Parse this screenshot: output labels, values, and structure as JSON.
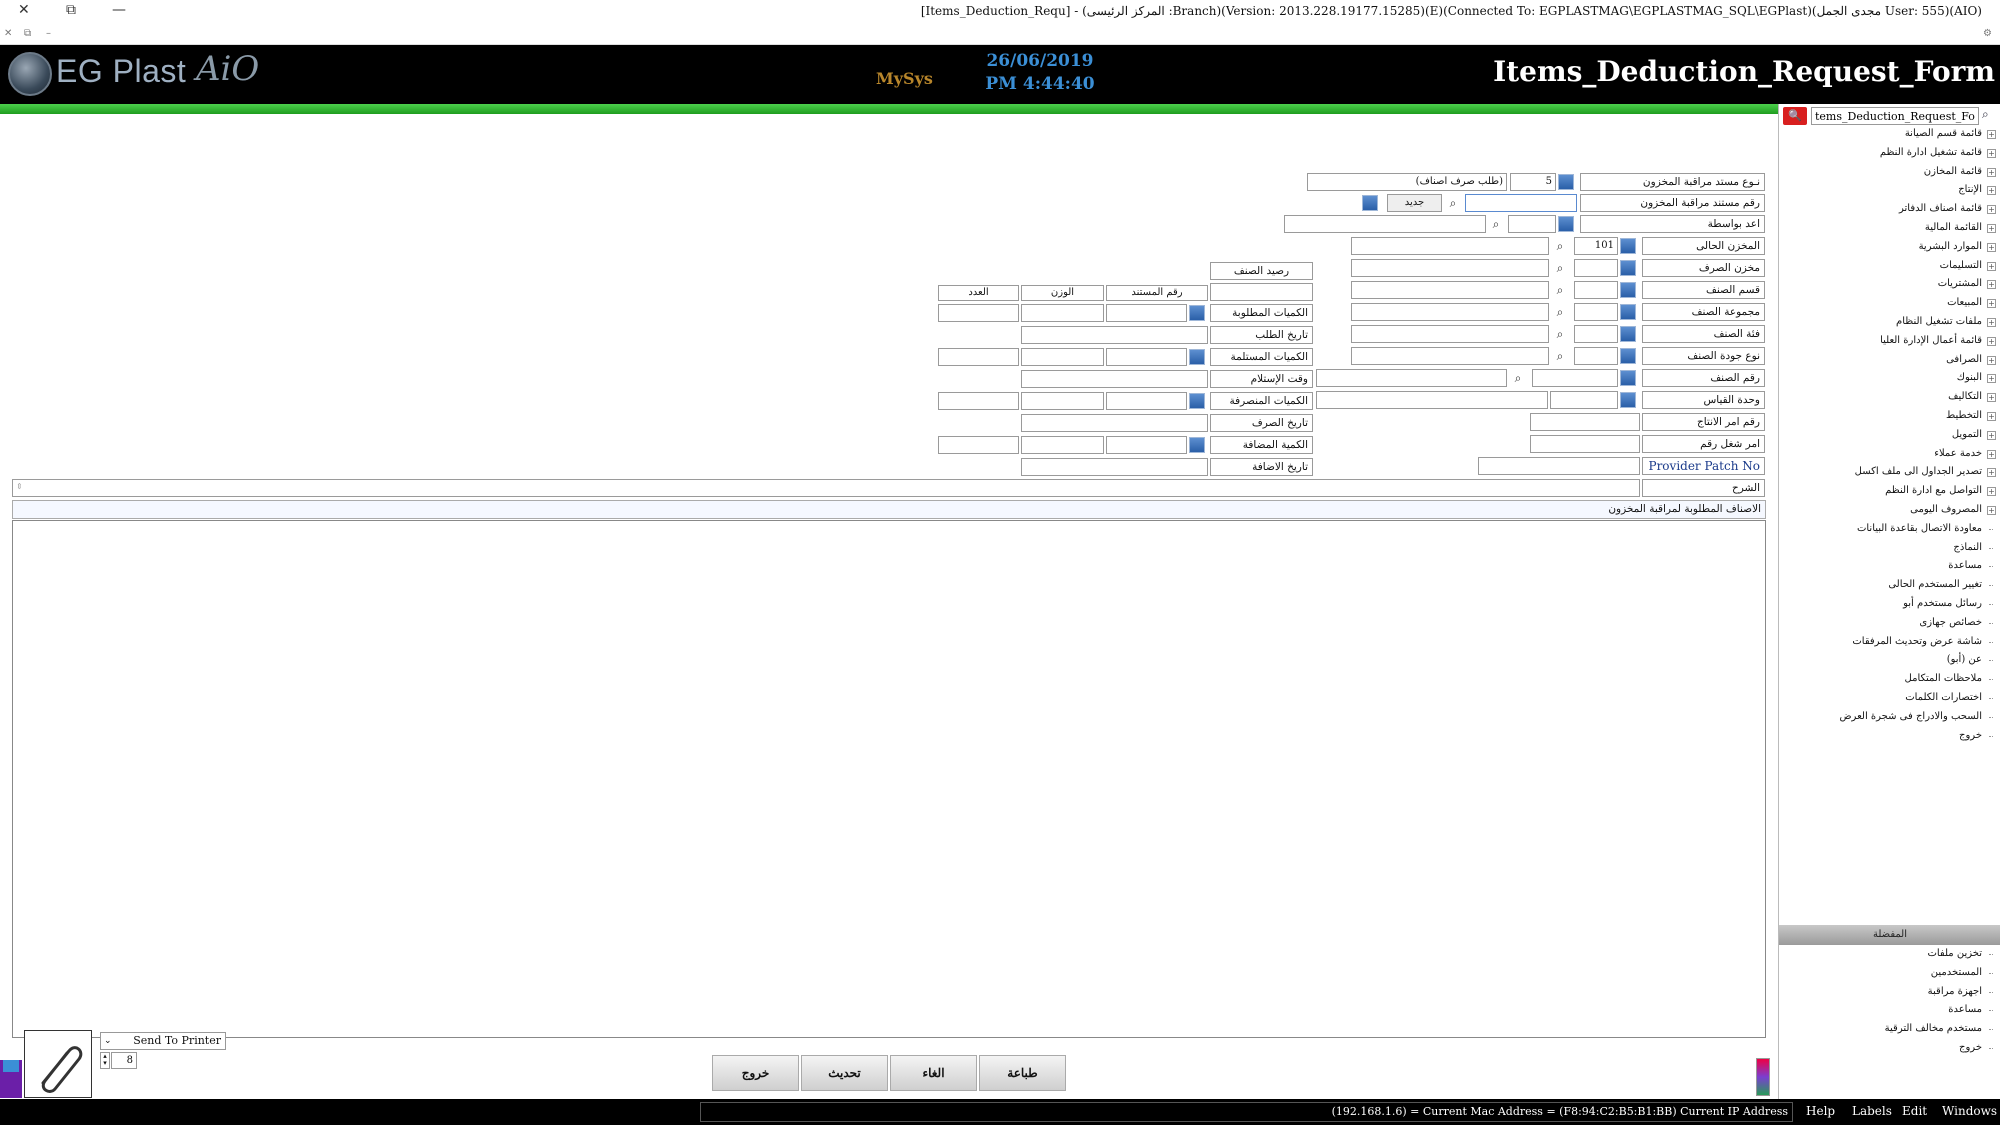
{
  "window": {
    "title": "[Items_Deduction_Requ] - (المركز الرئيسى :Branch)(Version: 2013.228.19177.15285)(E)(Connected To: EGPLASTMAG\\EGPLASTMAG_SQL\\EGPlast)(مجدى الجمل User: 555)(AIO)",
    "close": "✕",
    "restore": "⧉",
    "minimize": "—"
  },
  "header": {
    "logo_text": "EG Plast",
    "logo_suffix": "AiO",
    "mysys": "MySys",
    "date": "26/06/2019",
    "time": "PM 4:44:40",
    "form_title": "Items_Deduction_Request_Form"
  },
  "sidebar": {
    "search_value": "tems_Deduction_Request_Form",
    "tree": [
      {
        "label": "قائمة قسم الصيانة",
        "expand": true
      },
      {
        "label": "قائمة تشغيل ادارة النظم",
        "expand": true
      },
      {
        "label": "قائمة المخازن",
        "expand": true
      },
      {
        "label": "الإنتاج",
        "expand": true
      },
      {
        "label": "قائمة اصناف الدفاتر",
        "expand": true
      },
      {
        "label": "القائمة المالية",
        "expand": true
      },
      {
        "label": "الموارد البشرية",
        "expand": true
      },
      {
        "label": "التسليمات",
        "expand": true
      },
      {
        "label": "المشتريات",
        "expand": true
      },
      {
        "label": "المبيعات",
        "expand": true
      },
      {
        "label": "ملفات تشغيل النظام",
        "expand": true
      },
      {
        "label": "قائمة أعمال الإدارة العليا",
        "expand": true
      },
      {
        "label": "الصرافى",
        "expand": true
      },
      {
        "label": "البنوك",
        "expand": true
      },
      {
        "label": "التكاليف",
        "expand": true
      },
      {
        "label": "التخطيط",
        "expand": true
      },
      {
        "label": "التمويل",
        "expand": true
      },
      {
        "label": "خدمة عملاء",
        "expand": true
      },
      {
        "label": "تصدير الجداول الى ملف اكسل",
        "expand": true
      },
      {
        "label": "التواصل مع ادارة النظم",
        "expand": true
      },
      {
        "label": "المصروف اليومى",
        "expand": true
      },
      {
        "label": "معاودة الاتصال بقاعدة البيانات",
        "expand": false
      },
      {
        "label": "النماذج",
        "expand": false
      },
      {
        "label": "مساعدة",
        "expand": false
      },
      {
        "label": "تغيير المستخدم الحالى",
        "expand": false
      },
      {
        "label": "رسائل مستخدم أبو",
        "expand": false
      },
      {
        "label": "خصائص جهازى",
        "expand": false
      },
      {
        "label": "شاشة عرض وتحديث المرفقات",
        "expand": false
      },
      {
        "label": "عن (أبو)",
        "expand": false
      },
      {
        "label": "ملاحظات المتكامل",
        "expand": false
      },
      {
        "label": "اختصارات الكلمات",
        "expand": false
      },
      {
        "label": "السحب والادراج فى شجرة العرض",
        "expand": false
      },
      {
        "label": "خروج",
        "expand": false
      }
    ],
    "favorites_title": "المفضلة",
    "favorites": [
      {
        "label": "تخزين ملفات"
      },
      {
        "label": "المستخدمين"
      },
      {
        "label": "اجهزة مراقبة"
      },
      {
        "label": "مساعدة"
      },
      {
        "label": "مستخدم مخالف الترقية"
      },
      {
        "label": "خروج"
      }
    ]
  },
  "form": {
    "doc_type_label": "نـوع مستد مراقبة المخزون",
    "doc_type_code": "5",
    "doc_type_name": "(طلب صرف اصناف)",
    "doc_no_label": "رقم مستند مراقبة المخزون",
    "doc_no_value": "",
    "new_button": "جديد",
    "prepared_by_label": "اعد بواسطة",
    "current_store_label": "المخزن الحالى",
    "current_store_code": "101",
    "issue_store_label": "مخزن الصرف",
    "item_section_label": "قسم الصنف",
    "item_group_label": "مجموعة الصنف",
    "item_category_label": "فئة الصنف",
    "item_quality_label": "نوع جودة الصنف",
    "item_no_label": "رقم الصنف",
    "unit_label": "وحدة القياس",
    "prod_order_label": "رقم امر الانتاج",
    "work_order_label": "امر شغل رقم",
    "provider_patch_label": "Provider Patch No",
    "notes_label": "الشرح",
    "item_balance_label": "رصيد الصنف",
    "col_doc_no": "رقم المستند",
    "col_weight": "الوزن",
    "col_count": "العدد",
    "req_qty_label": "الكميات المطلوبة",
    "req_date_label": "تاريخ الطلب",
    "recv_qty_label": "الكميات المستلمة",
    "recv_time_label": "وقت الإستلام",
    "issued_qty_label": "الكميات المنصرفة",
    "issue_date_label": "تاريخ الصرف",
    "added_qty_label": "الكمية المضافة",
    "add_date_label": "تاريخ الاضافة",
    "grid_title": "الاصناف المطلوبة لمراقبة المخزون"
  },
  "bottom": {
    "send_to_printer": "Send To Printer",
    "copies": "8",
    "print_button": "طباعة",
    "cancel_button": "الغاء",
    "update_button": "تحديث",
    "exit_button": "خروج"
  },
  "statusbar": {
    "ip_text": "(192.168.1.6) = Current Mac Address = (F8:94:C2:B5:B1:BB) Current IP Address",
    "menu": [
      "Help",
      "Labels",
      "Edit",
      "Windows"
    ]
  },
  "colors": {
    "accent_green": "#1f9d1f",
    "header_bg": "#000000",
    "date_blue": "#3b8fd6",
    "search_red": "#d81f1f"
  }
}
